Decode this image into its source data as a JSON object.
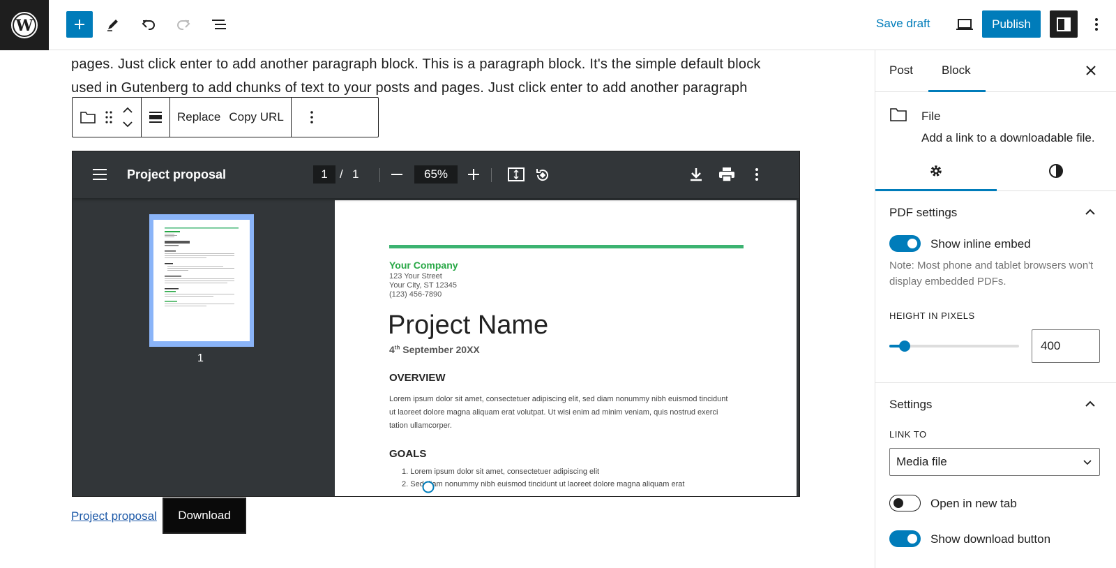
{
  "topbar": {
    "save_draft": "Save draft",
    "publish": "Publish"
  },
  "content": {
    "paragraph": "pages. Just click enter to add another paragraph block. This is a paragraph block. It's the simple default block used in Gutenberg to add chunks of text to your posts and pages. Just click enter to add another paragraph",
    "toolbar": {
      "replace": "Replace",
      "copy_url": "Copy URL"
    },
    "pdf_viewer": {
      "title": "Project proposal",
      "page_current": "1",
      "page_separator": "/",
      "page_total": "1",
      "zoom": "65%",
      "thumb_page_num": "1",
      "document": {
        "company": "Your Company",
        "address1": "123 Your Street",
        "address2": "Your City, ST 12345",
        "phone": "(123) 456-7890",
        "project_name": "Project Name",
        "date_day": "4",
        "date_sup": "th",
        "date_rest": " September 20XX",
        "overview_heading": "OVERVIEW",
        "overview_text": "Lorem ipsum dolor sit amet, consectetuer adipiscing elit, sed diam nonummy nibh euismod tincidunt ut laoreet dolore magna aliquam erat volutpat. Ut wisi enim ad minim veniam, quis nostrud exerci tation ullamcorper.",
        "goals_heading": "GOALS",
        "goal1": "1.      Lorem ipsum dolor sit amet, consectetuer adipiscing elit",
        "goal2": "2.      Sed diam nonummy nibh euismod tincidunt ut laoreet dolore magna aliquam erat"
      }
    },
    "file_link": "Project proposal",
    "download_button": "Download"
  },
  "sidebar": {
    "tabs": [
      "Post",
      "Block"
    ],
    "active_tab": "Block",
    "block_title": "File",
    "block_description": "Add a link to a downloadable file.",
    "pdf_settings": {
      "heading": "PDF settings",
      "show_inline_embed": "Show inline embed",
      "show_inline_embed_on": true,
      "note": "Note: Most phone and tablet browsers won't display embedded PDFs.",
      "height_label": "HEIGHT IN PIXELS",
      "height_value": "400"
    },
    "settings": {
      "heading": "Settings",
      "link_to_label": "LINK TO",
      "link_to_value": "Media file",
      "open_new_tab": "Open in new tab",
      "open_new_tab_on": false,
      "show_download_button": "Show download button",
      "show_download_button_on": true
    }
  },
  "colors": {
    "accent": "#007cba",
    "dark": "#1e1e1e",
    "viewer_bg": "#323639",
    "company_green": "#27a745"
  }
}
